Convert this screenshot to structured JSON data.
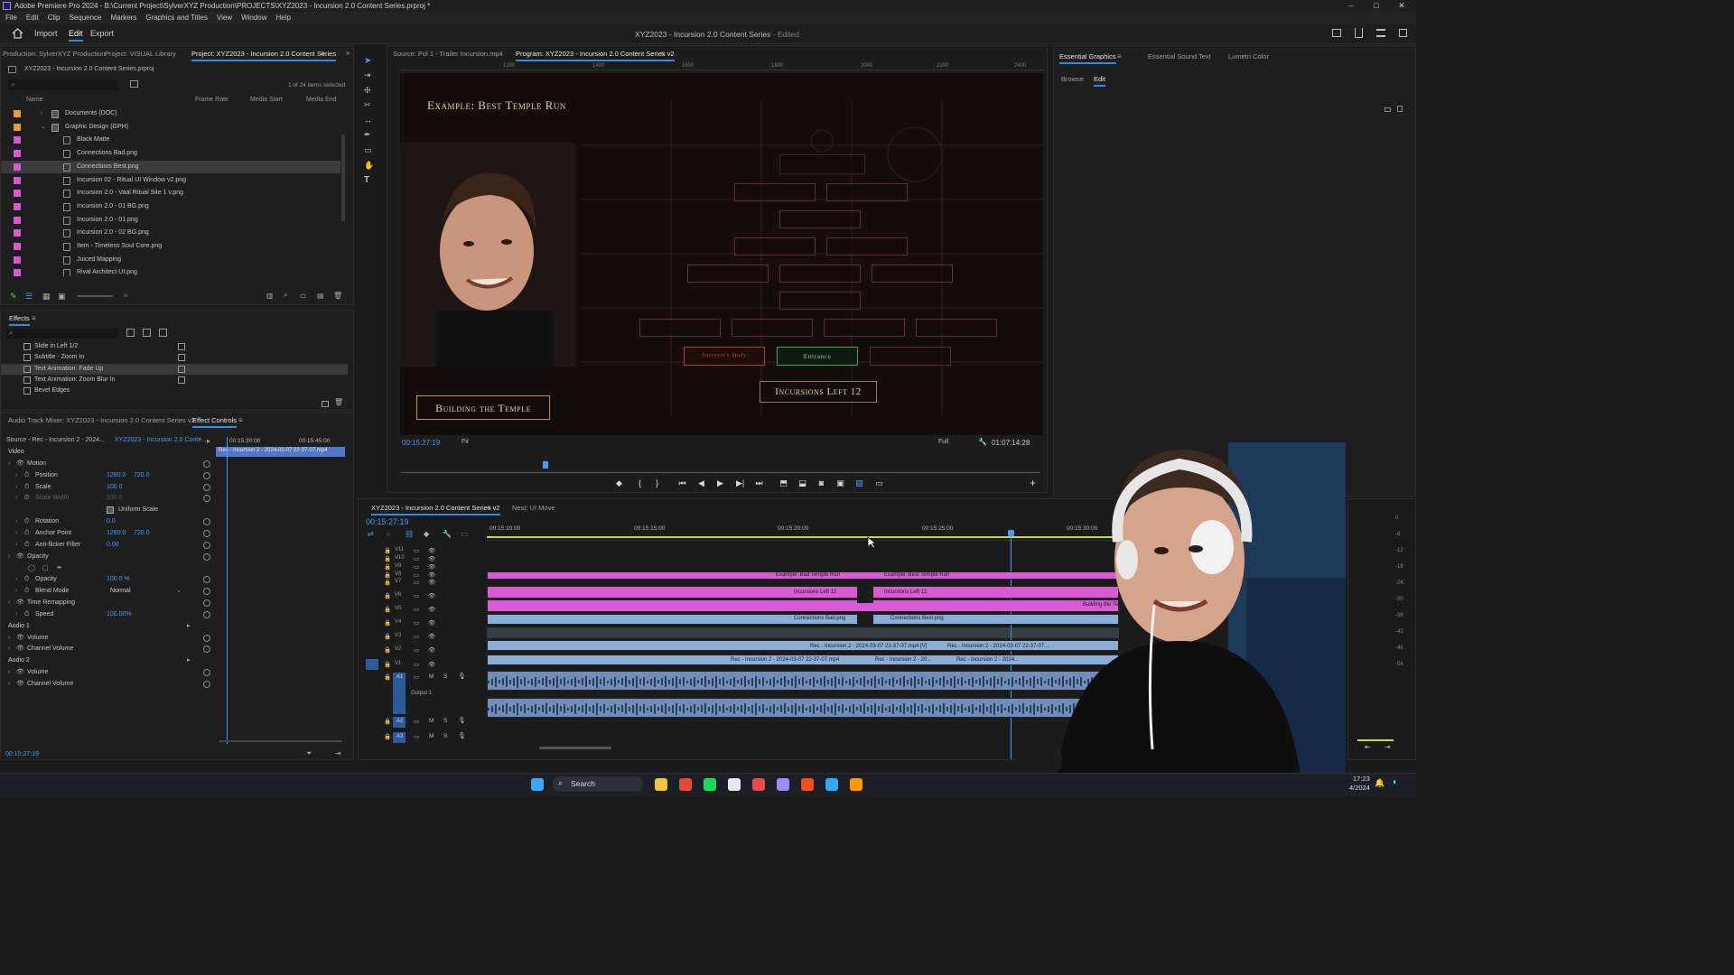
{
  "window": {
    "title": "Adobe Premiere Pro 2024 - B:\\Current Project\\SylverXYZ Production\\PROJECTS\\XYZ2023 - Incursion 2.0 Content Series.prproj *",
    "controls": [
      "–",
      "□",
      "✕"
    ]
  },
  "menu": [
    "File",
    "Edit",
    "Clip",
    "Sequence",
    "Markers",
    "Graphics and Titles",
    "View",
    "Window",
    "Help"
  ],
  "workspace": {
    "tabs": [
      "Import",
      "Edit",
      "Export"
    ],
    "active": "Edit",
    "document_title": "XYZ2023 - Incursion 2.0 Content Series",
    "doc_status": "- Edited"
  },
  "project_panel": {
    "tabs": [
      "Production: SylverXYZ Production",
      "Project: VISUAL Library",
      "Project: XYZ2023 - Incursion 2.0 Content Series"
    ],
    "active_tab": "Project: XYZ2023 - Incursion 2.0 Content Series",
    "project_file": "XYZ2023 - Incursion 2.0 Content Series.prproj",
    "selection_count": "1 of 24 items selected",
    "columns": [
      "Name",
      "Frame Rate",
      "Media Start",
      "Media End"
    ],
    "items": [
      {
        "name": "Documents (DOC)",
        "type": "folder",
        "color": "#e89a3c"
      },
      {
        "name": "Graphic Design (GPH)",
        "type": "folder",
        "color": "#e89a3c"
      },
      {
        "name": "Black Matte",
        "type": "file",
        "color": "#d958d0"
      },
      {
        "name": "Connections Bad.png",
        "type": "file",
        "color": "#d958d0"
      },
      {
        "name": "Connections Best.png",
        "type": "file",
        "color": "#d958d0",
        "selected": true
      },
      {
        "name": "Incursion 02 - Ritual UI Window v2.png",
        "type": "file",
        "color": "#d958d0"
      },
      {
        "name": "Incursion 2.0 - Vaal Ritual Site 1 v.png",
        "type": "file",
        "color": "#d958d0"
      },
      {
        "name": "Incursion 2.0 - 01 BG.png",
        "type": "file",
        "color": "#d958d0"
      },
      {
        "name": "Incursion 2.0 - 01.png",
        "type": "file",
        "color": "#d958d0"
      },
      {
        "name": "Incursion 2.0 - 02 BG.png",
        "type": "file",
        "color": "#d958d0"
      },
      {
        "name": "Item - Timeless Soul Core.png",
        "type": "file",
        "color": "#d958d0"
      },
      {
        "name": "Juiced Mapping",
        "type": "file",
        "color": "#d958d0"
      },
      {
        "name": "Rival Architect UI.png",
        "type": "file",
        "color": "#d958d0"
      }
    ]
  },
  "effects_panel": {
    "title": "Effects",
    "items": [
      {
        "name": "Slide in Left 1/2"
      },
      {
        "name": "Subtitle - Zoom In"
      },
      {
        "name": "Text Animation: Fade Up",
        "selected": true
      },
      {
        "name": "Text Animation: Zoom Blur In"
      },
      {
        "name": "Bevel Edges"
      }
    ]
  },
  "effect_controls": {
    "tabs": [
      "Audio Track Mixer: XYZ2023 - Incursion 2.0 Content Series v2",
      "Effect Controls"
    ],
    "active_tab": "Effect Controls",
    "source": "Source - Rec - Incursion 2 - 2024...",
    "sequence": "XYZ2023 - Incursion 2.0 Conte...",
    "ruler_start": "00:15:30:00",
    "ruler_end": "00:15:45:00",
    "clip_name": "Rec - Incursion 2 - 2024-03-07 22-37-07.mp4",
    "rows": [
      {
        "name": "Video",
        "type": "section"
      },
      {
        "name": "Motion",
        "type": "group"
      },
      {
        "name": "Position",
        "v1": "1280.0",
        "v2": "720.0"
      },
      {
        "name": "Scale",
        "v1": "100.0"
      },
      {
        "name": "Scale Width",
        "v1": "100.0",
        "disabled": true
      },
      {
        "name": "Uniform Scale",
        "type": "checkbox"
      },
      {
        "name": "Rotation",
        "v1": "0.0"
      },
      {
        "name": "Anchor Point",
        "v1": "1280.0",
        "v2": "720.0"
      },
      {
        "name": "Anti-flicker Filter",
        "v1": "0.00"
      },
      {
        "name": "Opacity",
        "type": "group"
      },
      {
        "name": "mask-tools",
        "type": "tools"
      },
      {
        "name": "Opacity",
        "v1": "100.0 %"
      },
      {
        "name": "Blend Mode",
        "v1": "Normal",
        "type": "select"
      },
      {
        "name": "Time Remapping",
        "type": "group"
      },
      {
        "name": "Speed",
        "v1": "100.00%"
      },
      {
        "name": "Audio 1",
        "type": "section"
      },
      {
        "name": "Volume",
        "type": "group"
      },
      {
        "name": "Channel Volume",
        "type": "group"
      },
      {
        "name": "Audio 2",
        "type": "section"
      },
      {
        "name": "Volume",
        "type": "group"
      },
      {
        "name": "Channel Volume",
        "type": "group"
      }
    ],
    "timecode": "00:15:27:19"
  },
  "source_monitor": {
    "tab": "Source: Pol 1 - Trailer Incursion.mp4"
  },
  "program_monitor": {
    "tab": "Program: XYZ2023 - Incursion 2.0 Content Series v2",
    "ruler": [
      "1200",
      "1400",
      "1600",
      "1800",
      "2000",
      "2200",
      "2400"
    ],
    "timecode": "00:15:27:19",
    "fit": "Fit",
    "quality": "Full",
    "duration": "01:07:14:28",
    "video": {
      "heading": "Example: Best Temple Run",
      "footer_left": "Building the Temple",
      "footer_right": "Incursions Left 12",
      "room_red": "Surveyor's Study",
      "room_green": "Entrance"
    }
  },
  "essential_graphics": {
    "tabs": [
      "Essential Graphics",
      "Essential Sound",
      "Text",
      "Lumetri Color"
    ],
    "active_tab": "Essential Graphics",
    "subtabs": [
      "Browse",
      "Edit"
    ],
    "active_subtab": "Edit"
  },
  "timeline": {
    "tab": "XYZ2023 - Incursion 2.0 Content Series v2",
    "tab2": "Nest: UI Move",
    "timecode": "00:15:27:19",
    "ruler": [
      "00:15:10:00",
      "00:15:15:00",
      "00:15:20:00",
      "00:15:25:00",
      "00:15:30:00"
    ],
    "tracks_video": [
      "V11",
      "V10",
      "V9",
      "V8",
      "V7",
      "V6",
      "V5",
      "V4",
      "V3",
      "V2",
      "V1"
    ],
    "tracks_audio": [
      "A1",
      "A2",
      "A3"
    ],
    "audio_label": "Output 1",
    "clips": [
      {
        "label": "Example: Bad Temple Run"
      },
      {
        "label": "Example: Best Temple Run"
      },
      {
        "label": "Incursions Left 12"
      },
      {
        "label": "Incursions Left 12"
      },
      {
        "label": "Building the Te..."
      },
      {
        "label": "Connections Bad.png"
      },
      {
        "label": "Connections Best.png"
      },
      {
        "label": "Rec - Incursion 2 - 2024-03-07 22-37-07.mp4 [V]"
      },
      {
        "label": "Rec - Incursion 2 - 2024-03-07 22-37-07..."
      },
      {
        "label": "Rec - Incursion 2 - 2024-03-07 22-37-07.mp4"
      },
      {
        "label": "Rec - Incursion 2 - 20..."
      },
      {
        "label": "Rec - Incursion 2 - 2024..."
      }
    ],
    "meter_scale": [
      "0",
      "-6",
      "-12",
      "-18",
      "-24",
      "-30",
      "-36",
      "-42",
      "-48",
      "-54"
    ]
  },
  "taskbar": {
    "search": "Search",
    "time": "17:23",
    "date": "4/2024",
    "apps": [
      {
        "name": "windows-start",
        "color": "#3ea6ff"
      },
      {
        "name": "explorer",
        "color": "#f0c43c"
      },
      {
        "name": "chrome",
        "color": "#e34a3c"
      },
      {
        "name": "spotify",
        "color": "#1ed760"
      },
      {
        "name": "notion",
        "color": "#e8e8e8"
      },
      {
        "name": "obs",
        "color": "#e84a4a"
      },
      {
        "name": "premiere",
        "color": "#9a8cff"
      },
      {
        "name": "figma",
        "color": "#f24e1e"
      },
      {
        "name": "photoshop",
        "color": "#31a8ff"
      },
      {
        "name": "illustrator",
        "color": "#ff9a00"
      }
    ]
  },
  "colors": {
    "accent": "#2d8ceb",
    "timecode": "#4a9bf5",
    "clip_pink": "#d85ad4",
    "clip_blue": "#8aaed8",
    "audio_clip": "#6f8fb8",
    "program_playhead": "#4a9bf5"
  }
}
